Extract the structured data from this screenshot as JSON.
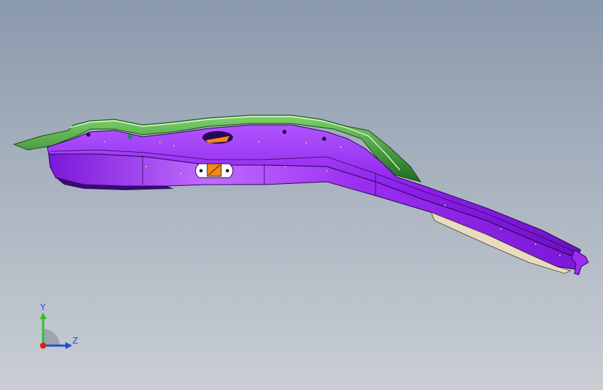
{
  "viewport": {
    "background_top": "#8b99ad",
    "background_bottom": "#c9ced4"
  },
  "model": {
    "part_color": "#9b2cf0",
    "flange_color": "#3f9a36",
    "insert_color": "#f08a1a"
  },
  "triad": {
    "x_axis_color": "#e0201c",
    "y_axis_color": "#2fbf2f",
    "z_axis_color": "#1f4fd1",
    "y_label": "Y",
    "z_label": "Z"
  }
}
